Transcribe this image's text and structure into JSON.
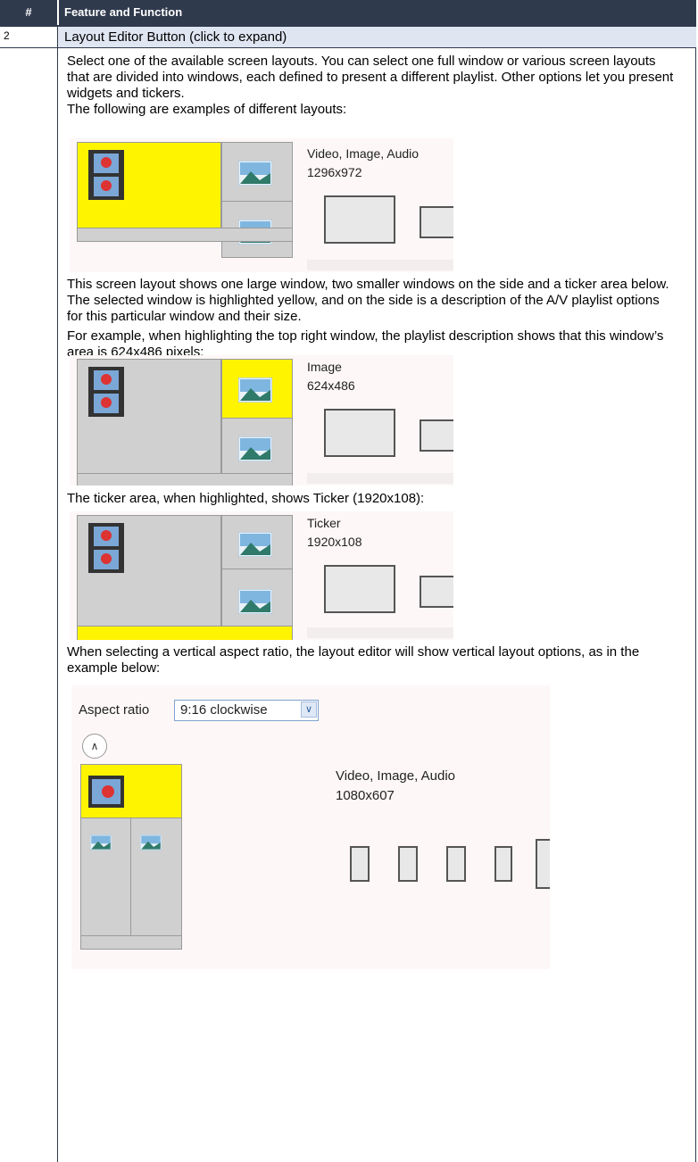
{
  "header": {
    "num_col": "#",
    "feature_col": "Feature and Function"
  },
  "row": {
    "num": "2",
    "title": "Layout Editor Button (click to expand)"
  },
  "paragraphs": {
    "p1": "Select one of the available screen layouts. You can select one full window or various screen layouts that are divided into windows, each defined to present a different playlist. Other options let you present widgets and tickers.",
    "p2": "The following are examples of different layouts:",
    "p3": "This screen layout shows one large window, two smaller windows on the side and a ticker area below. The selected window is highlighted yellow, and on the side is a description of the A/V playlist options for this particular window and their size.",
    "p4": "For example, when highlighting the top right window, the playlist description shows that this window’s area is 624x486 pixels:",
    "p5": "The ticker area, when highlighted, shows Ticker (1920x108):",
    "p6": "When selecting a vertical aspect ratio, the layout editor will show vertical layout options, as in the example below:"
  },
  "shots": {
    "s1": {
      "type": "Video, Image, Audio",
      "size": "1296x972"
    },
    "s2": {
      "type": "Image",
      "size": "624x486"
    },
    "s3": {
      "type": "Ticker",
      "size": "1920x108"
    },
    "s4": {
      "aspect_label": "Aspect ratio",
      "aspect_value": "9:16 clockwise",
      "type": "Video, Image, Audio",
      "size": "1080x607"
    }
  },
  "colors": {
    "header_bg": "#2f3a4d",
    "row_bg": "#dfe5f1",
    "highlight": "#fef400"
  },
  "icons": [
    "film-strip-icon",
    "landscape-image-icon",
    "chevron-up-icon",
    "dropdown-arrow-icon",
    "layout-option-icon"
  ]
}
